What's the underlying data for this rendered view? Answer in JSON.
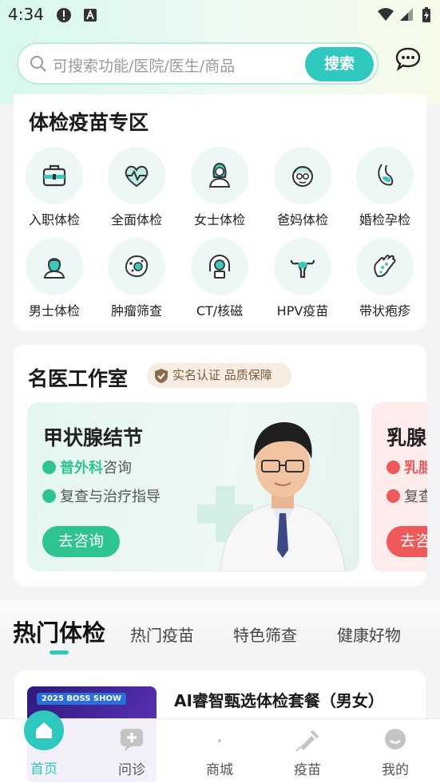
{
  "status_bar": {
    "time": "4:34"
  },
  "search": {
    "placeholder": "可搜索功能/医院/医生/商品",
    "button": "搜索"
  },
  "vaccine_section": {
    "title": "体检疫苗专区",
    "items": [
      {
        "label": "入职体检",
        "icon": "briefcase-icon"
      },
      {
        "label": "全面体检",
        "icon": "heart-pulse-icon"
      },
      {
        "label": "女士体检",
        "icon": "woman-icon"
      },
      {
        "label": "爸妈体检",
        "icon": "elderly-icon"
      },
      {
        "label": "婚检孕检",
        "icon": "pregnancy-icon"
      },
      {
        "label": "男士体检",
        "icon": "man-icon"
      },
      {
        "label": "肿瘤筛查",
        "icon": "cell-icon"
      },
      {
        "label": "CT/核磁",
        "icon": "ct-scanner-icon"
      },
      {
        "label": "HPV疫苗",
        "icon": "uterus-icon"
      },
      {
        "label": "带状疱疹",
        "icon": "hand-rash-icon"
      }
    ]
  },
  "doctor_section": {
    "title": "名医工作室",
    "badge": "实名认证 品质保障",
    "cards": [
      {
        "title": "甲状腺结节",
        "dept": "普外科",
        "dept_suffix": "咨询",
        "line2": "复查与治疗指导",
        "button": "去咨询",
        "accent": "#2ec48f"
      },
      {
        "title": "乳腺",
        "dept": "乳腺",
        "dept_suffix": "",
        "line2": "复查",
        "button": "去咨",
        "accent": "#ee5a5a"
      }
    ]
  },
  "tabs": [
    {
      "label": "热门体检",
      "active": true
    },
    {
      "label": "热门疫苗",
      "active": false
    },
    {
      "label": "特色筛查",
      "active": false
    },
    {
      "label": "健康好物",
      "active": false
    }
  ],
  "package": {
    "name": "AI睿智甄选体检套餐（男女）",
    "thumb_text": "2025 BOSS SHOW"
  },
  "bottom_nav": [
    {
      "label": "首页",
      "icon": "home-icon",
      "active": true
    },
    {
      "label": "问诊",
      "icon": "consult-icon",
      "active": false
    },
    {
      "label": "商城",
      "icon": "mall-icon",
      "active": false
    },
    {
      "label": "疫苗",
      "icon": "syringe-icon",
      "active": false
    },
    {
      "label": "我的",
      "icon": "profile-icon",
      "active": false
    }
  ],
  "colors": {
    "accent": "#2ec8be",
    "green": "#2ec48f",
    "red": "#ee5a5a"
  }
}
